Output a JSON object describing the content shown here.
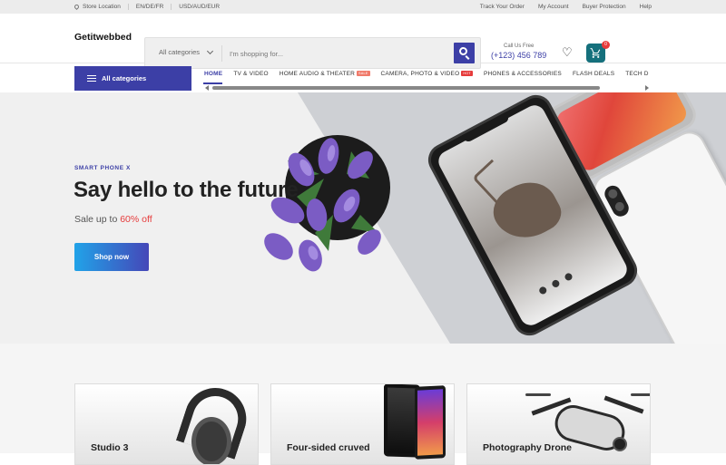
{
  "topbar": {
    "store_location": "Store Location",
    "languages": "EN/DE/FR",
    "currencies": "USD/AUD/EUR",
    "links": [
      "Track Your Order",
      "My Account",
      "Buyer Protection",
      "Help"
    ]
  },
  "header": {
    "logo": "Getitwebbed",
    "search": {
      "category_label": "All categories",
      "placeholder": "I'm shopping for..."
    },
    "call": {
      "label": "Call Us Free",
      "phone": "(+123) 456 789"
    },
    "cart_count": "0"
  },
  "nav": {
    "all_categories": "All categories",
    "links": [
      {
        "label": "HOME",
        "tag": ""
      },
      {
        "label": "TV & VIDEO",
        "tag": ""
      },
      {
        "label": "HOME AUDIO & THEATER",
        "tag": "SALE"
      },
      {
        "label": "CAMERA, PHOTO & VIDEO",
        "tag": "HOT"
      },
      {
        "label": "PHONES & ACCESSORIES",
        "tag": ""
      },
      {
        "label": "FLASH DEALS",
        "tag": ""
      },
      {
        "label": "TECH D",
        "tag": ""
      }
    ]
  },
  "hero": {
    "eyebrow": "SMART PHONE X",
    "headline": "Say hello to the future",
    "sale_prefix": "Sale up to",
    "sale_value": "60% off",
    "cta": "Shop now"
  },
  "cards": [
    {
      "title": "Studio 3"
    },
    {
      "title": "Four-sided cruved"
    },
    {
      "title": "Photography Drone"
    }
  ],
  "colors": {
    "accent": "#3c3fa6",
    "sale_red": "#e63b3b",
    "cart_teal": "#15707c",
    "hot_tag": "#e63b3b",
    "sale_tag": "#f07a6a"
  },
  "icons": [
    "location-pin-icon",
    "chevron-down-icon",
    "search-icon",
    "heart-icon",
    "cart-icon",
    "menu-icon",
    "arrow-left-icon",
    "arrow-right-icon"
  ]
}
